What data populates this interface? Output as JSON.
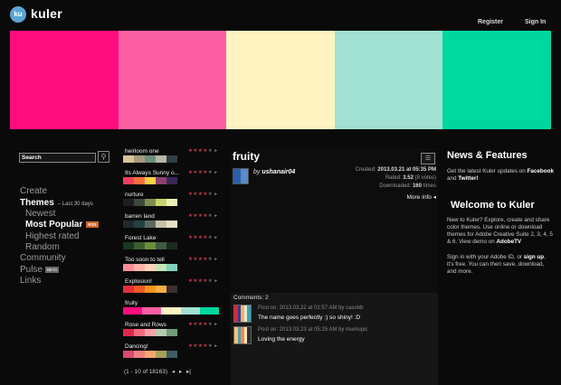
{
  "header": {
    "logo_badge": "ku",
    "logo_text": "kuler",
    "register": "Register",
    "sign_in": "Sign In"
  },
  "hero_colors": [
    "#ff0d7e",
    "#fb5fa2",
    "#fff4c1",
    "#a1e1d2",
    "#00d79f"
  ],
  "search": {
    "label": "Search",
    "icon": "search-user-icon"
  },
  "nav": {
    "create": "Create",
    "themes": "Themes",
    "themes_sub": "Last 30 days",
    "newest": "Newest",
    "most_popular": "Most Popular",
    "rss": "RSS",
    "highest_rated": "Highest rated",
    "random": "Random",
    "community": "Community",
    "pulse": "Pulse",
    "beta": "BETA",
    "links": "Links"
  },
  "themes": [
    {
      "name": "heirloom one",
      "stars": 4,
      "colors": [
        "#d9c494",
        "#a59a7f",
        "#6d8e7b",
        "#b5b7a3",
        "#2e3f46"
      ]
    },
    {
      "name": "Its Always Sunny o...",
      "stars": 4,
      "colors": [
        "#f03e5e",
        "#ff6f3c",
        "#ffcf48",
        "#8e3f6e",
        "#3a2a55"
      ]
    },
    {
      "name": "nurture",
      "stars": 4,
      "colors": [
        "#1f1f1f",
        "#3b4a3a",
        "#7d8f50",
        "#c8d36d",
        "#eaf2b8"
      ]
    },
    {
      "name": "barren land",
      "stars": 4,
      "colors": [
        "#1c2a2e",
        "#244045",
        "#5a6b5d",
        "#c0c5a2",
        "#e5e1c2"
      ]
    },
    {
      "name": "Forest Lake",
      "stars": 4,
      "colors": [
        "#173a20",
        "#395f2e",
        "#6c8f3b",
        "#3d5a42",
        "#1b2b1f"
      ]
    },
    {
      "name": "Too soon to tell",
      "stars": 4,
      "colors": [
        "#ff8a9a",
        "#ffb3a8",
        "#ffd3b6",
        "#c5e6b6",
        "#7fd3b8"
      ]
    },
    {
      "name": "Explosion!",
      "stars": 4,
      "colors": [
        "#e32e39",
        "#f15a24",
        "#f7941d",
        "#fbb040",
        "#3d2f2f"
      ]
    },
    {
      "name": "fruity",
      "stars": 4,
      "colors": [
        "#ff0d7e",
        "#fb5fa2",
        "#fff4c1",
        "#a1e1d2",
        "#00d79f"
      ],
      "selected": true
    },
    {
      "name": "Rose and Rows",
      "stars": 4,
      "colors": [
        "#e0264d",
        "#f26a7e",
        "#f6a2a6",
        "#b8c9b0",
        "#6f9d7a"
      ]
    },
    {
      "name": "Dancing!",
      "stars": 4,
      "colors": [
        "#d94b6b",
        "#f07f80",
        "#f3a66f",
        "#a6a05b",
        "#3e5a62"
      ]
    }
  ],
  "pager": {
    "text": "(1 - 10 of 18163)"
  },
  "detail": {
    "title": "fruity",
    "by_prefix": "by",
    "author": "ushanair04",
    "created_label": "Created:",
    "created_value": "2013.03.21 at 05:35 PM",
    "rated_label": "Rated:",
    "rated_value": "3.52",
    "rated_votes": "(8 votes)",
    "downloaded_label": "Downloaded:",
    "downloaded_value": "160",
    "downloaded_suffix": "times",
    "more_info": "More Info"
  },
  "comments": {
    "header": "Comments: 2",
    "items": [
      {
        "date": "Post on: 2013.03.22 at 01:57 AM by casobb",
        "text": "The name goes perfectly :) so shiny! :D",
        "colors": [
          "#e6202c",
          "#2f3d9a",
          "#f0b55a",
          "#e8e6d4",
          "#37a6b1"
        ]
      },
      {
        "date": "Post on: 2013.03.23 at 05:25 AM by mumupic",
        "text": "Loving the energy",
        "colors": [
          "#f7c36b",
          "#4f9fb8",
          "#f28a4a",
          "#f3e4b8",
          "#2f2f2f"
        ]
      }
    ]
  },
  "news": {
    "title": "News & Features",
    "text_pre": "Get the latest Kuler updates on",
    "facebook": "Facebook",
    "and": "and",
    "twitter": "Twitter!"
  },
  "welcome": {
    "title": "Welcome to Kuler",
    "p1": "New to Kuler? Explore, create and share color themes. Use online or download themes for Adobe Creative Suite 2, 3, 4, 5 & 6. View demo on",
    "adobetv": "AdobeTV",
    "p2_pre": "Sign in with your Adobe ID, or",
    "sign_up": "sign up",
    "p2_post": ", it's free. You can then save, download, and more."
  }
}
